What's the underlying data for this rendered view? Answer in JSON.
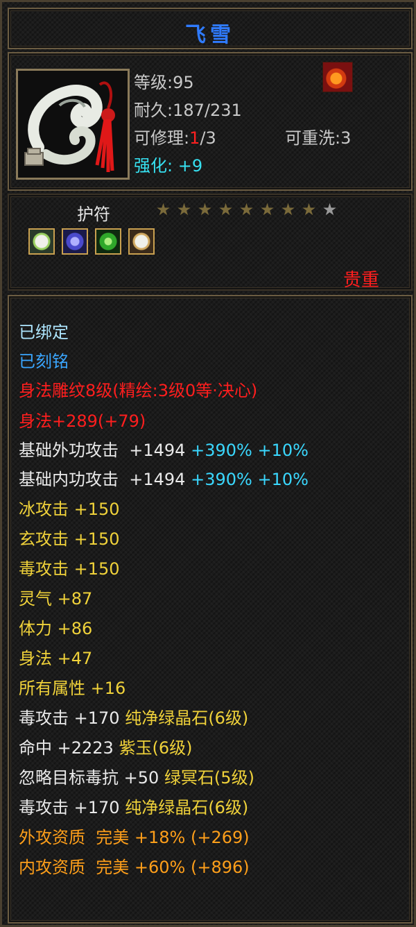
{
  "item": {
    "name": "飞雪",
    "level": "等级:95",
    "durability": "耐久:187/231",
    "repair_prefix": "可修理:",
    "repair_used": "1",
    "repair_total": "/3",
    "rewash": "可重洗:3",
    "enhance_label": "强化:",
    "enhance_value": "+9",
    "type": "护符",
    "stars_filled": 8,
    "stars_total": 9,
    "rarity": "贵重"
  },
  "status": {
    "bound": "已绑定",
    "engraved": "已刻铭"
  },
  "carving": "身法雕纹8级(精绘:3级0等·决心)",
  "carving_bonus": "身法+289(+79)",
  "base_attacks": [
    {
      "label": "基础外功攻击",
      "value": "+1494",
      "pct": "+390%",
      "extra": "+10%"
    },
    {
      "label": "基础内功攻击",
      "value": "+1494",
      "pct": "+390%",
      "extra": "+10%"
    }
  ],
  "attributes": [
    {
      "label": "冰攻击",
      "value": "+150"
    },
    {
      "label": "玄攻击",
      "value": "+150"
    },
    {
      "label": "毒攻击",
      "value": "+150"
    },
    {
      "label": "灵气",
      "value": "+87"
    },
    {
      "label": "体力",
      "value": "+86"
    },
    {
      "label": "身法",
      "value": "+47"
    },
    {
      "label": "所有属性",
      "value": "+16"
    }
  ],
  "gems": [
    {
      "label": "毒攻击",
      "value": "+170",
      "gem": "纯净绿晶石(6级)"
    },
    {
      "label": "命中",
      "value": "+2223",
      "gem": "紫玉(6级)"
    },
    {
      "label": "忽略目标毒抗",
      "value": "+50",
      "gem": "绿冥石(5级)"
    },
    {
      "label": "毒攻击",
      "value": "+170",
      "gem": "纯净绿晶石(6级)"
    }
  ],
  "aptitudes": [
    {
      "label": "外攻资质",
      "grade": "完美",
      "pct": "+18%",
      "bonus": "(+269)"
    },
    {
      "label": "内攻资质",
      "grade": "完美",
      "pct": "+60%",
      "bonus": "(+896)"
    }
  ],
  "colors": {
    "title": "#2f7bff",
    "red": "#ff1e1e",
    "cyan": "#3ad8ff",
    "yellow": "#f0d23a",
    "orange": "#ff9f1a",
    "white": "#eaeaea"
  },
  "slots": [
    "pearl-slot",
    "blue-crystal-slot",
    "green-gem-slot",
    "pearl-slot"
  ]
}
